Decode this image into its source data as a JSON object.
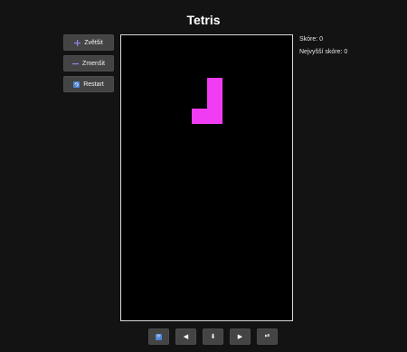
{
  "title": "Tetris",
  "buttons": {
    "zoom_in": {
      "label": "Zvětšit",
      "icon": "plus-icon"
    },
    "zoom_out": {
      "label": "Zmenšit",
      "icon": "minus-icon"
    },
    "restart": {
      "label": "Restart",
      "icon": "restart-icon"
    }
  },
  "score": {
    "current": "Skóre: 0",
    "best": "Nejvyšší skóre: 0"
  },
  "game": {
    "piece": "J",
    "piece_color": "#f03cf2",
    "cells": [
      [
        1,
        0
      ],
      [
        1,
        1
      ],
      [
        0,
        2
      ],
      [
        1,
        2
      ]
    ]
  },
  "controls": [
    {
      "name": "rotate-button",
      "icon": "rotate-icon",
      "glyph": ""
    },
    {
      "name": "left-button",
      "icon": "left-arrow-icon",
      "glyph": "◀"
    },
    {
      "name": "down-button",
      "icon": "down-arrow-icon",
      "glyph": "⬇"
    },
    {
      "name": "right-button",
      "icon": "right-arrow-icon",
      "glyph": "▶"
    },
    {
      "name": "drop-button",
      "icon": "drop-icon",
      "glyph": "⏯"
    }
  ],
  "colors": {
    "background": "#131313",
    "button": "#444444",
    "board_border": "#d8d8d8",
    "accent_blue": "#4f86d8"
  }
}
